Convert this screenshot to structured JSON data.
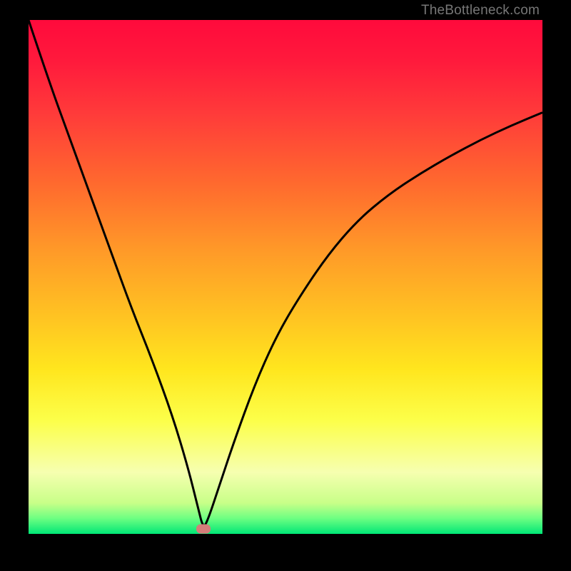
{
  "watermark": "TheBottleneck.com",
  "colors": {
    "curve": "#000000",
    "marker": "#d47d7a",
    "frame": "#000000"
  },
  "chart_data": {
    "type": "line",
    "title": "",
    "xlabel": "",
    "ylabel": "",
    "xlim": [
      0,
      100
    ],
    "ylim": [
      0,
      100
    ],
    "grid": false,
    "legend": null,
    "annotations": [
      {
        "type": "marker",
        "x": 34,
        "y": 1,
        "shape": "pill",
        "color": "#d47d7a"
      }
    ],
    "series": [
      {
        "name": "bottleneck-curve",
        "x": [
          0,
          4,
          8,
          12,
          16,
          20,
          24,
          28,
          31,
          33,
          34,
          35,
          37,
          40,
          44,
          48,
          52,
          58,
          64,
          70,
          76,
          82,
          88,
          94,
          100
        ],
        "y": [
          100,
          88,
          77,
          66,
          55,
          44,
          34,
          23,
          13,
          5,
          1,
          3,
          9,
          18,
          29,
          38,
          45,
          54,
          61,
          66,
          70,
          73.5,
          76.7,
          79.5,
          82
        ]
      }
    ],
    "background_gradient": {
      "direction": "top-to-bottom",
      "stops": [
        {
          "pos": 0,
          "color": "#ff0a3c"
        },
        {
          "pos": 0.45,
          "color": "#ff9a28"
        },
        {
          "pos": 0.78,
          "color": "#fcff4a"
        },
        {
          "pos": 1.0,
          "color": "#00e676"
        }
      ]
    }
  }
}
